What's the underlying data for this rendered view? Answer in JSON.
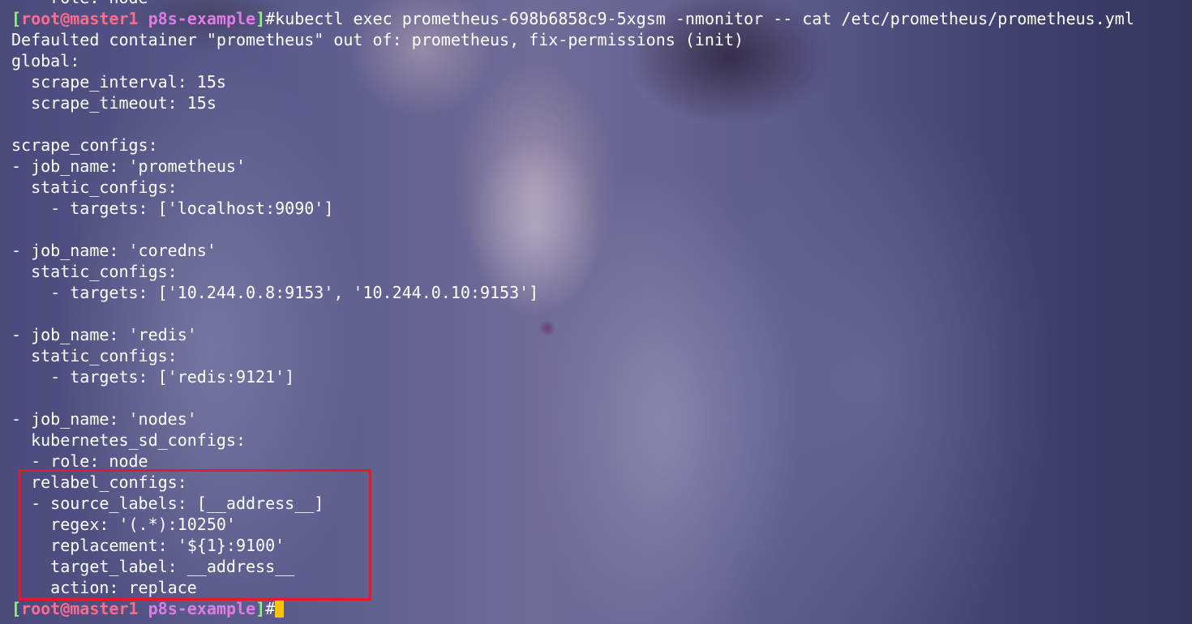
{
  "colors": {
    "prompt_bracket": "#8ef47c",
    "prompt_user": "#ff6b8a",
    "prompt_host": "#ff6b8a",
    "prompt_path": "#e07be6",
    "cursor": "#f7c600",
    "highlight_border": "#e8182a",
    "text": "#ffffff"
  },
  "prompt": {
    "open_bracket": "[",
    "user": "root",
    "at": "@",
    "host": "master1",
    "space": " ",
    "path": "p8s-example",
    "close_bracket": "]",
    "symbol": "#"
  },
  "command": "kubectl exec prometheus-698b6858c9-5xgsm -nmonitor -- cat /etc/prometheus/prometheus.yml",
  "output_lines": [
    "Defaulted container \"prometheus\" out of: prometheus, fix-permissions (init)",
    "global:",
    "  scrape_interval: 15s",
    "  scrape_timeout: 15s",
    "",
    "scrape_configs:",
    "- job_name: 'prometheus'",
    "  static_configs:",
    "    - targets: ['localhost:9090']",
    "",
    "- job_name: 'coredns'",
    "  static_configs:",
    "    - targets: ['10.244.0.8:9153', '10.244.0.10:9153']",
    "",
    "- job_name: 'redis'",
    "  static_configs:",
    "    - targets: ['redis:9121']",
    "",
    "- job_name: 'nodes'",
    "  kubernetes_sd_configs:",
    "  - role: node",
    "  relabel_configs:",
    "  - source_labels: [__address__]",
    "    regex: '(.*):10250'",
    "    replacement: '${1}:9100'",
    "    target_label: __address__",
    "    action: replace"
  ],
  "scrolled_partial_line": "    role: node"
}
